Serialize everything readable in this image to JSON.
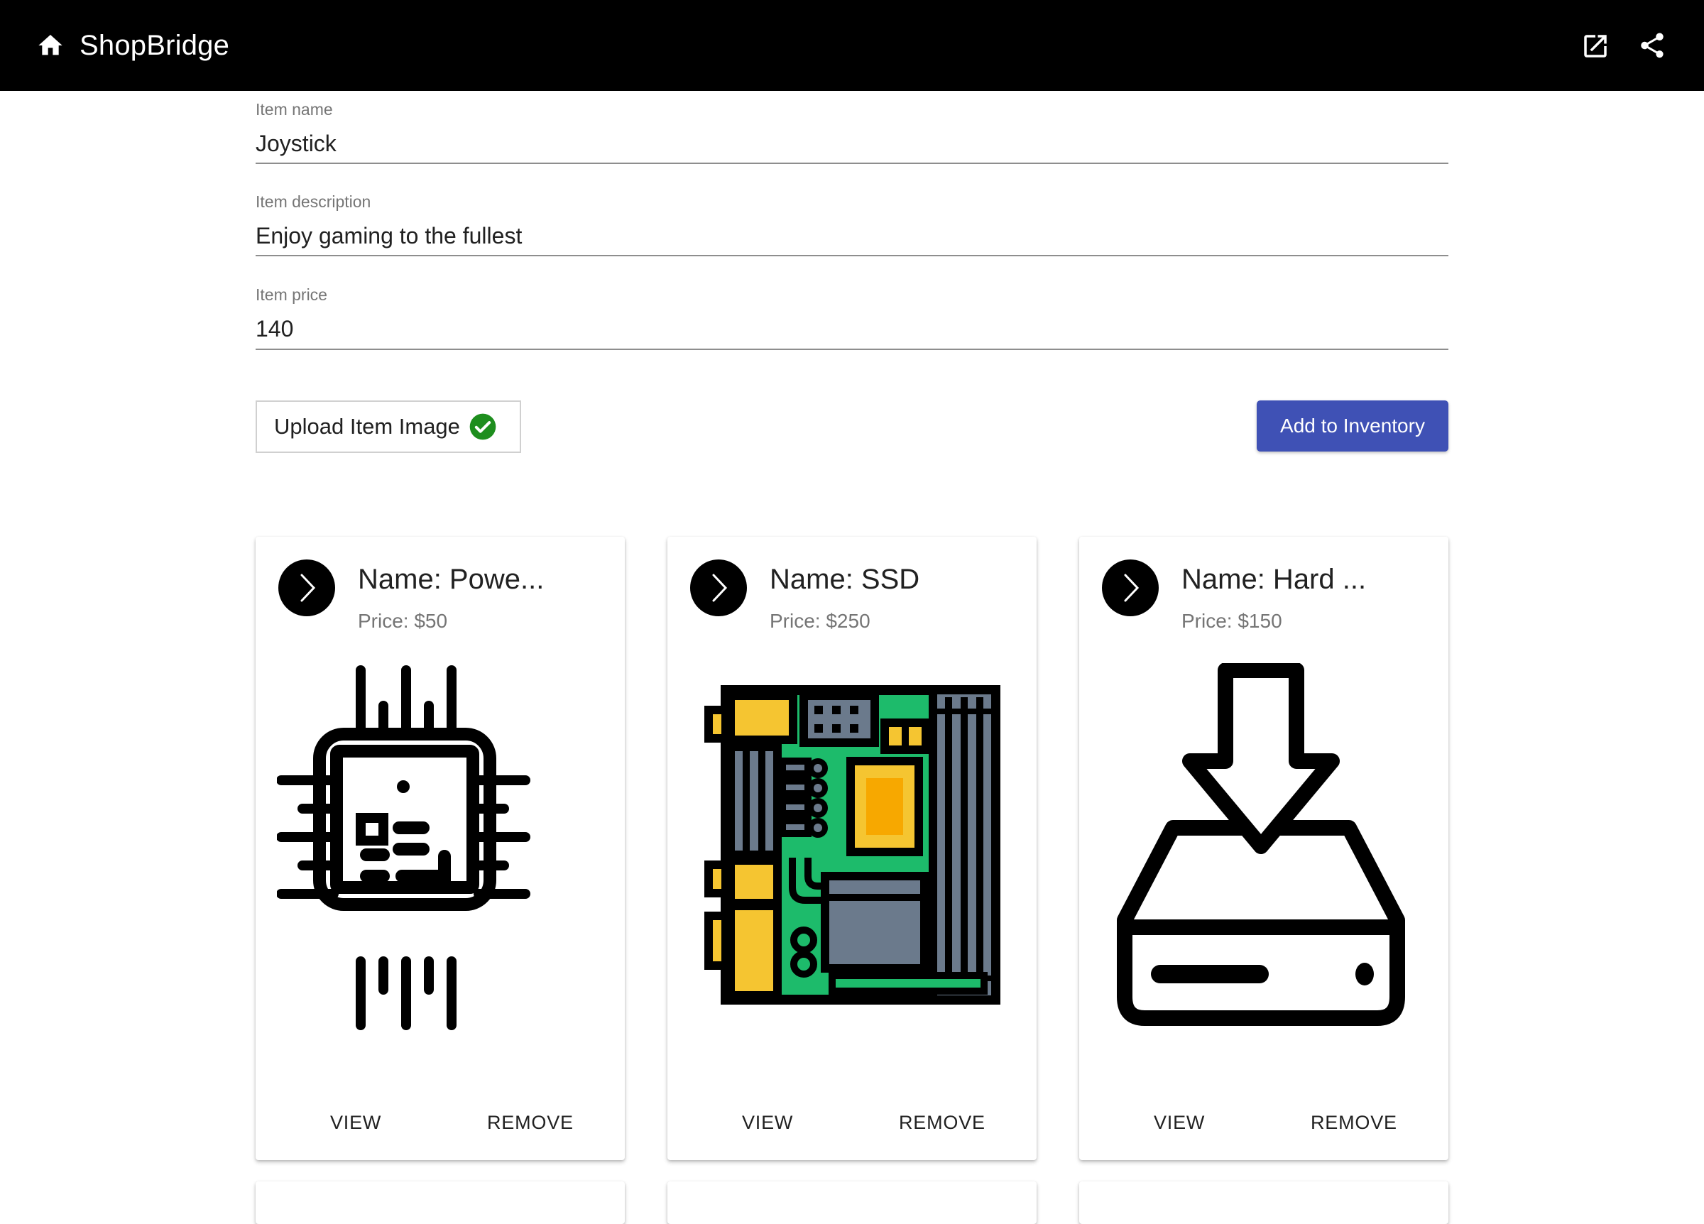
{
  "app": {
    "title": "ShopBridge"
  },
  "form": {
    "name": {
      "label": "Item name",
      "value": "Joystick"
    },
    "description": {
      "label": "Item description",
      "value": "Enjoy gaming to the fullest"
    },
    "price": {
      "label": "Item price",
      "value": "140"
    },
    "upload_label": "Upload Item Image",
    "add_label": "Add to Inventory"
  },
  "cards": [
    {
      "title": "Name: Powe...",
      "price": "Price: $50",
      "image": "cpu-chip-icon",
      "view": "VIEW",
      "remove": "REMOVE"
    },
    {
      "title": "Name: SSD",
      "price": "Price: $250",
      "image": "motherboard-icon",
      "view": "VIEW",
      "remove": "REMOVE"
    },
    {
      "title": "Name: Hard ...",
      "price": "Price: $150",
      "image": "hard-drive-download-icon",
      "view": "VIEW",
      "remove": "REMOVE"
    }
  ],
  "colors": {
    "appbar": "#000000",
    "primary": "#3f51b5",
    "success": "#1e8e1e"
  }
}
